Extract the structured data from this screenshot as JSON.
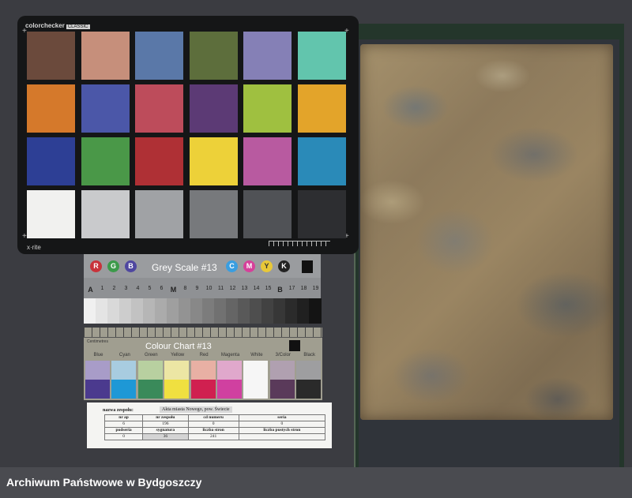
{
  "colorchecker": {
    "brand": "colorchecker",
    "badge": "CLASSIC",
    "maker": "x·rite",
    "patches": [
      "#6b4a3c",
      "#c68f7b",
      "#5a78a8",
      "#5d6e3c",
      "#8580b6",
      "#62c5ad",
      "#d5792b",
      "#4b57a8",
      "#bd4c5b",
      "#5c3a75",
      "#9fc040",
      "#e3a42a",
      "#2d3f95",
      "#4a9848",
      "#af3035",
      "#edd139",
      "#b85aa0",
      "#2a8ab8",
      "#f1f1ef",
      "#c9cacc",
      "#a0a2a5",
      "#77797c",
      "#505256",
      "#2d2e31"
    ]
  },
  "grey_scale": {
    "title": "Grey Scale #13",
    "rgb": [
      "R",
      "G",
      "B"
    ],
    "cmyk": [
      "C",
      "M",
      "Y",
      "K"
    ],
    "dot_colors": [
      "#c8323a",
      "#3c9a4a",
      "#4f47a0",
      "#3a9ee0",
      "#d6409a",
      "#e8c838",
      "#222222"
    ],
    "steps": [
      "A",
      "1",
      "2",
      "3",
      "4",
      "5",
      "6",
      "M",
      "8",
      "9",
      "10",
      "11",
      "12",
      "13",
      "14",
      "15",
      "B",
      "17",
      "18",
      "19"
    ]
  },
  "colour_chart": {
    "title": "Colour Chart #13",
    "unit_label": "Centimetres",
    "labels": [
      "Blue",
      "Cyan",
      "Green",
      "Yellow",
      "Red",
      "Magenta",
      "White",
      "3/Color",
      "Black"
    ],
    "top_colors": [
      "#a89cc8",
      "#a8cce0",
      "#b8d0a0",
      "#ece6a4",
      "#e8b0a4",
      "#e0a8cc",
      "#f6f6f6",
      "#b0a0b0",
      "#9e9ea0"
    ],
    "bottom_colors": [
      "#4b3a8e",
      "#1e98d6",
      "#3a8a5a",
      "#f0e040",
      "#d02050",
      "#d040a0",
      "#f6f6f6",
      "#5a3a5a",
      "#2a2a2a"
    ]
  },
  "archive_label": {
    "name_label": "nazwa zespołu:",
    "name_value": "Akta miasta Nowego, pow. Świecie",
    "row1_headers": [
      "nr ap",
      "nr zespołu",
      "cd numeru",
      "seria"
    ],
    "row1_values": [
      "6",
      "196",
      "0",
      "0"
    ],
    "row2_headers": [
      "podseria",
      "sygnatura",
      "liczba stron",
      "liczba pustych stron"
    ],
    "row2_values": [
      "0",
      "36",
      "241",
      ""
    ]
  },
  "caption": "Archiwum Państwowe w Bydgoszczy"
}
